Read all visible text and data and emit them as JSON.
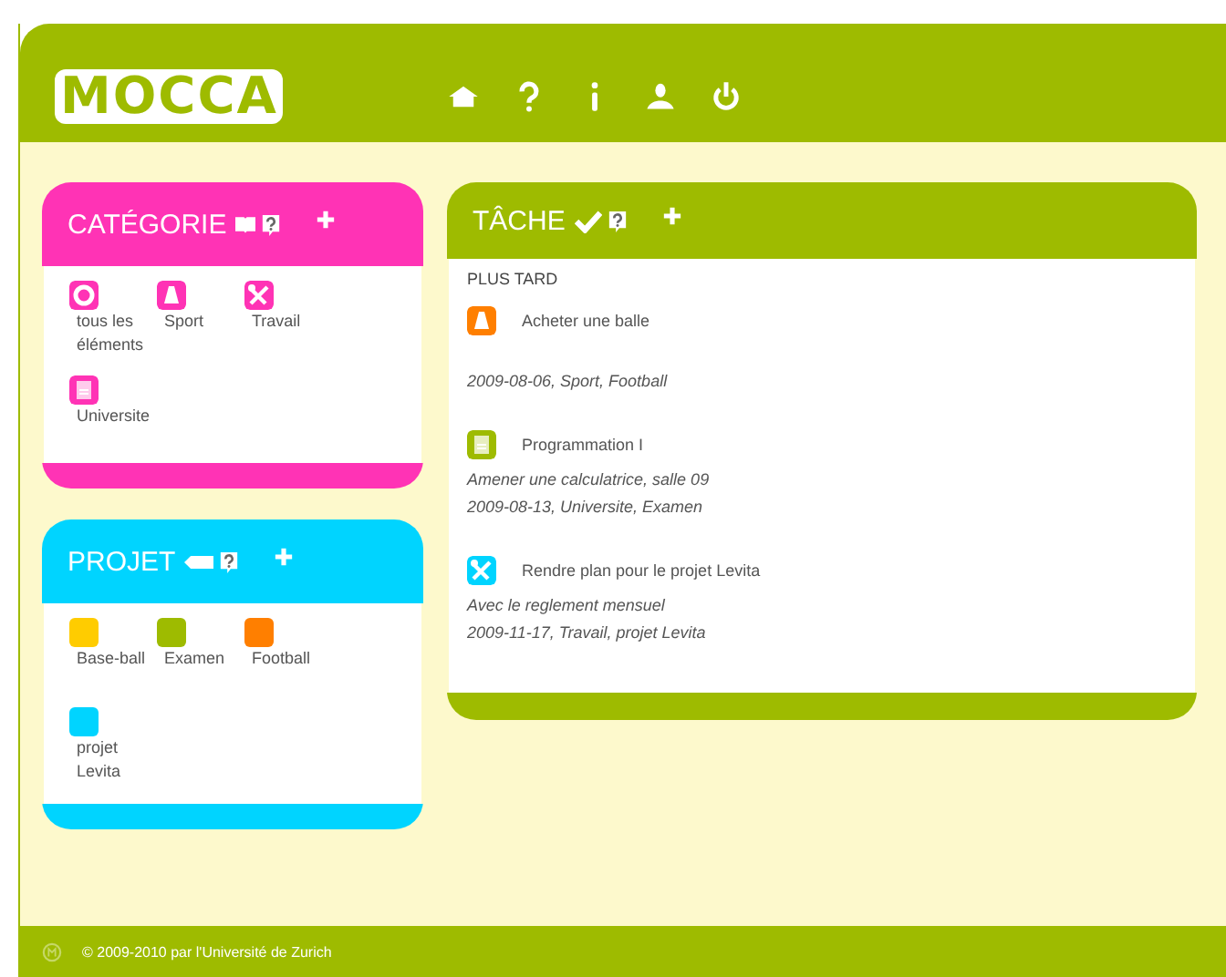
{
  "logo": "MOCCA",
  "nav": [
    {
      "kind": "home"
    },
    {
      "kind": "help"
    },
    {
      "kind": "info"
    },
    {
      "kind": "user"
    },
    {
      "kind": "power"
    }
  ],
  "categories": {
    "title": "CATÉGORIE",
    "items": [
      {
        "label": "tous les éléments",
        "kind": "ring"
      },
      {
        "label": "Sport",
        "kind": "cone"
      },
      {
        "label": "Travail",
        "kind": "tools"
      },
      {
        "label": "Universite",
        "kind": "document"
      }
    ]
  },
  "projects": {
    "title": "PROJET",
    "items": [
      {
        "label": "Base-ball",
        "color": "#ffcc00"
      },
      {
        "label": "Examen",
        "color": "#9ebb00"
      },
      {
        "label": "Football",
        "color": "#ff7f00"
      },
      {
        "label": "projet Levita",
        "color": "#00d4ff"
      }
    ]
  },
  "tasks": {
    "title": "TÂCHE",
    "section": "PLUS TARD",
    "items": [
      {
        "title": "Acheter une balle",
        "kind": "cone",
        "color": "#ff7f00",
        "meta": "2009-08-06, Sport, Football"
      },
      {
        "title": "Programmation I",
        "kind": "document",
        "color": "#9ebb00",
        "note": "Amener une calculatrice, salle 09",
        "meta": "2009-08-13, Universite, Examen"
      },
      {
        "title": "Rendre plan pour le projet Levita",
        "kind": "tools",
        "color": "#00d4ff",
        "note": "Avec le reglement mensuel",
        "meta": "2009-11-17, Travail, projet Levita"
      }
    ]
  },
  "footer": "© 2009-2010 par l'Université de Zurich"
}
